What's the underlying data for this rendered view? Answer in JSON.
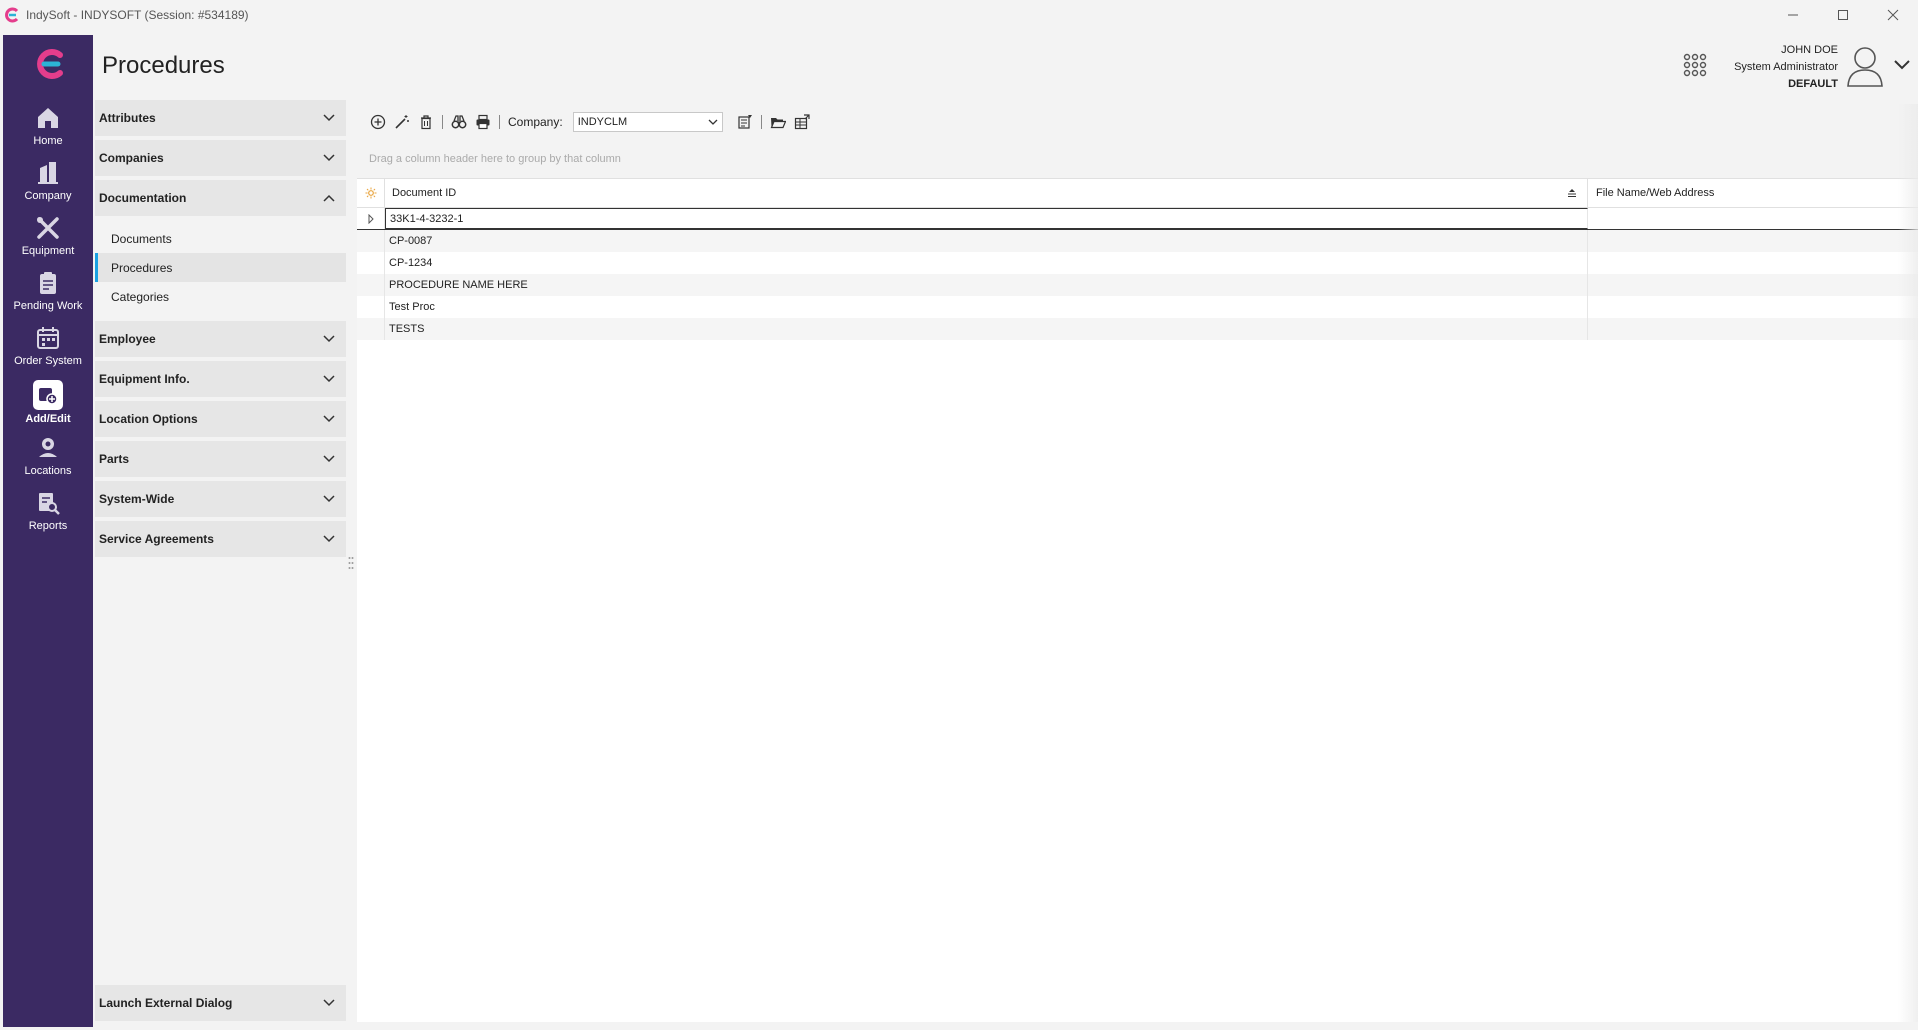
{
  "window": {
    "title": "IndySoft - INDYSOFT (Session: #534189)",
    "accent": "#3b2a63",
    "selection_accent": "#1ba1e2"
  },
  "nav": {
    "items": [
      {
        "label": "Home",
        "icon": "home-icon"
      },
      {
        "label": "Company",
        "icon": "building-icon"
      },
      {
        "label": "Equipment",
        "icon": "tools-icon"
      },
      {
        "label": "Pending Work",
        "icon": "clipboard-icon"
      },
      {
        "label": "Order System",
        "icon": "calendar-icon"
      },
      {
        "label": "Add/Edit",
        "icon": "add-edit-icon",
        "active": true
      },
      {
        "label": "Locations",
        "icon": "location-pin-icon"
      },
      {
        "label": "Reports",
        "icon": "report-search-icon"
      }
    ]
  },
  "page": {
    "title": "Procedures"
  },
  "user": {
    "name": "JOHN DOE",
    "role": "System Administrator",
    "database": "DEFAULT"
  },
  "sidebar": {
    "sections": [
      {
        "label": "Attributes",
        "expanded": false
      },
      {
        "label": "Companies",
        "expanded": false
      },
      {
        "label": "Documentation",
        "expanded": true,
        "items": [
          {
            "label": "Documents"
          },
          {
            "label": "Procedures",
            "selected": true
          },
          {
            "label": "Categories"
          }
        ]
      },
      {
        "label": "Employee",
        "expanded": false
      },
      {
        "label": "Equipment Info.",
        "expanded": false
      },
      {
        "label": "Location Options",
        "expanded": false
      },
      {
        "label": "Parts",
        "expanded": false
      },
      {
        "label": "System-Wide",
        "expanded": false
      },
      {
        "label": "Service Agreements",
        "expanded": false
      }
    ],
    "bottom_section": {
      "label": "Launch External Dialog"
    }
  },
  "toolbar": {
    "company_label": "Company:",
    "company_value": "INDYCLM"
  },
  "grid": {
    "group_hint": "Drag a column header here to group by that column",
    "columns": [
      "Document ID",
      "File Name/Web Address"
    ],
    "rows": [
      {
        "document_id": "33K1-4-3232-1",
        "file": ""
      },
      {
        "document_id": "CP-0087",
        "file": ""
      },
      {
        "document_id": "CP-1234",
        "file": ""
      },
      {
        "document_id": "PROCEDURE NAME HERE",
        "file": ""
      },
      {
        "document_id": "Test Proc",
        "file": ""
      },
      {
        "document_id": "TESTS",
        "file": ""
      }
    ]
  }
}
